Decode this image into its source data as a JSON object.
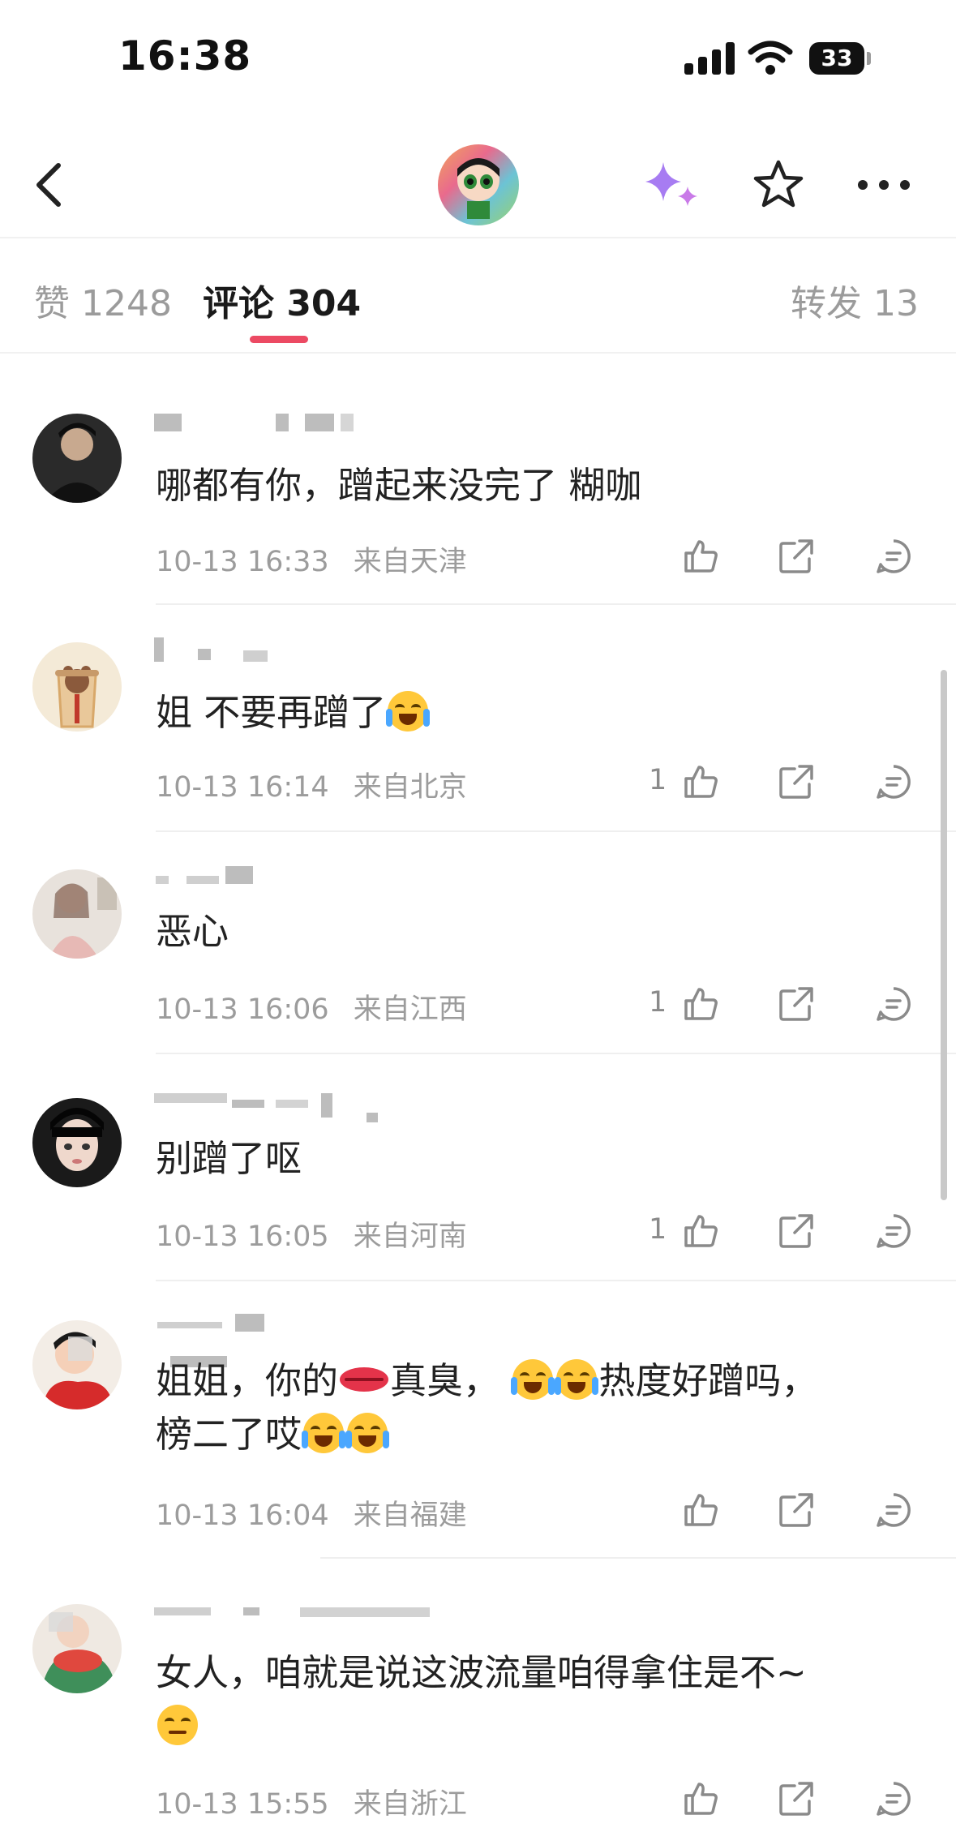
{
  "status_bar": {
    "time": "16:38",
    "battery": "33"
  },
  "tabs": {
    "likes": "赞 1248",
    "comments": "评论 304",
    "reposts": "转发 13"
  },
  "comments": [
    {
      "text": "哪都有你，蹭起来没完了 糊咖",
      "time": "10-13 16:33",
      "location": "来自天津",
      "likes": ""
    },
    {
      "text": "姐 不要再蹭了",
      "emoji": "😂",
      "time": "10-13 16:14",
      "location": "来自北京",
      "likes": "1"
    },
    {
      "text": "恶心",
      "time": "10-13 16:06",
      "location": "来自江西",
      "likes": "1"
    },
    {
      "text": "别蹭了呕",
      "time": "10-13 16:05",
      "location": "来自河南",
      "likes": "1"
    },
    {
      "text_parts": [
        "姐姐，你的",
        "真臭，",
        "热度好蹭吗，",
        "榜二了哎"
      ],
      "emojis": [
        "👄",
        "😭",
        "😭",
        "😭",
        "😭"
      ],
      "time": "10-13 16:04",
      "location": "来自福建",
      "likes": ""
    },
    {
      "text": "女人，咱就是说这波流量咱得拿住是不~",
      "emoji": "🤔",
      "time": "10-13 15:55",
      "location": "来自浙江",
      "likes": ""
    }
  ],
  "icons": {
    "back": "back-arrow-icon",
    "sparkle": "sparkle-icon",
    "favorite": "star-icon",
    "more": "more-icon",
    "like": "thumbs-up-icon",
    "share": "share-icon",
    "reply": "reply-icon"
  },
  "colors": {
    "accent": "#ec4a63",
    "sparkle": "#a77cf2",
    "meta_text": "#9c9c9c"
  }
}
